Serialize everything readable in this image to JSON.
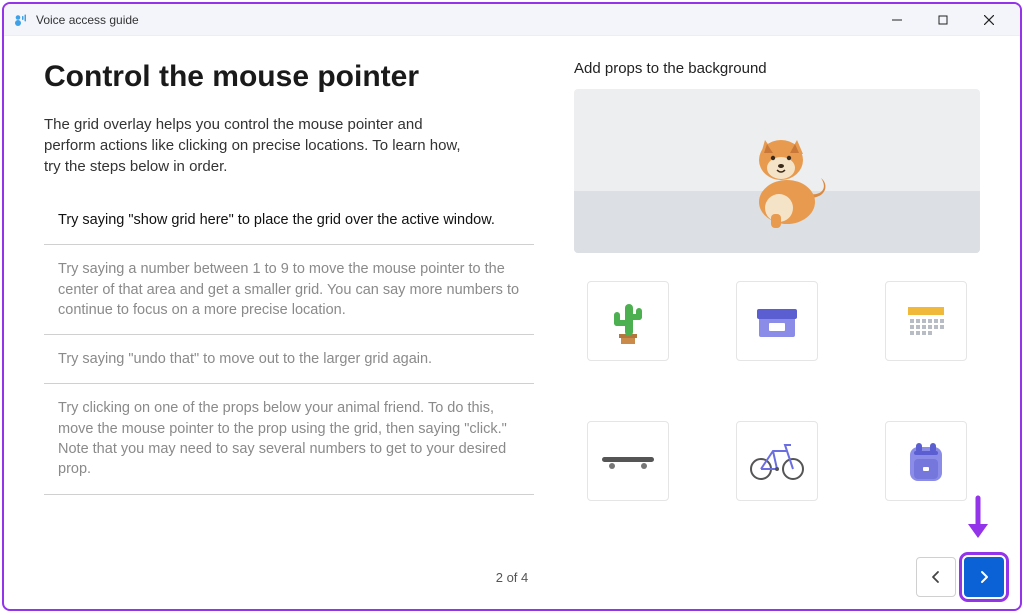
{
  "window": {
    "title": "Voice access guide"
  },
  "left": {
    "heading": "Control the mouse pointer",
    "intro": "The grid overlay helps you control the mouse pointer and perform actions like clicking on precise locations. To learn how, try the steps below in order.",
    "steps": [
      "Try saying \"show grid here\" to place the grid over the active window.",
      "Try saying a number between 1 to 9 to move the mouse pointer to the center of that area and get a smaller grid. You can say more numbers to continue to focus on a more precise location.",
      "Try saying \"undo that\" to move out to the larger grid again.",
      "Try clicking on one of the props below your animal friend. To do this, move the mouse pointer to the prop using the grid, then saying \"click.\" Note that you may need to say several numbers to get to your desired prop."
    ]
  },
  "right": {
    "title": "Add props to the background",
    "props": [
      "cactus",
      "box",
      "calendar",
      "skateboard",
      "bicycle",
      "backpack"
    ]
  },
  "footer": {
    "page_indicator": "2 of 4"
  }
}
